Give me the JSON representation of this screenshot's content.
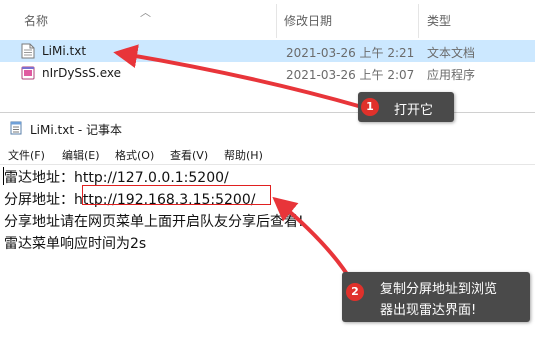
{
  "explorer": {
    "columns": {
      "name": "名称",
      "date": "修改日期",
      "type": "类型"
    },
    "files": [
      {
        "name": "LiMi.txt",
        "date": "2021-03-26 上午 2:21",
        "type": "文本文档",
        "icon": "text-file-icon",
        "selected": true
      },
      {
        "name": "nIrDySsS.exe",
        "date": "2021-03-26 上午 2:07",
        "type": "应用程序",
        "icon": "exe-file-icon",
        "selected": false
      }
    ]
  },
  "notepad": {
    "title": "LiMi.txt - 记事本",
    "menu": [
      "文件(F)",
      "编辑(E)",
      "格式(O)",
      "查看(V)",
      "帮助(H)"
    ],
    "lines": [
      "雷达地址：http://127.0.0.1:5200/",
      "分屏地址：http://192.168.3.15:5200/",
      "分享地址请在网页菜单上面开启队友分享后查看!",
      "雷达菜单响应时间为2s"
    ]
  },
  "annotations": [
    {
      "number": "1",
      "text": "打开它"
    },
    {
      "number": "2",
      "line1": "复制分屏地址到浏览",
      "line2": "器出现雷达界面!"
    }
  ],
  "colors": {
    "selection": "#cce8ff",
    "annotation_bg": "#4a4a4a",
    "badge": "#e0312b",
    "arrow": "#e8353a"
  }
}
